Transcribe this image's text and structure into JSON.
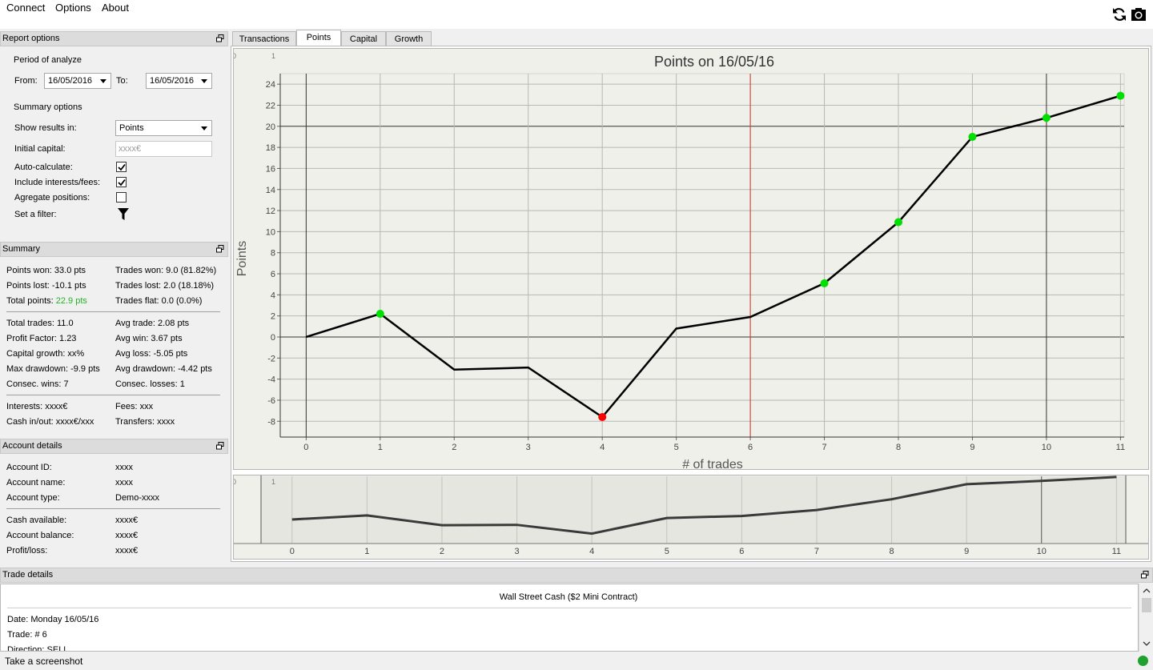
{
  "menu": {
    "connect": "Connect",
    "options": "Options",
    "about": "About"
  },
  "toolbar": {
    "refresh_icon": "refresh-icon",
    "camera_icon": "camera-icon"
  },
  "report_options": {
    "title": "Report options",
    "period_label": "Period of analyze",
    "from_label": "From:",
    "from_value": "16/05/2016",
    "to_label": "To:",
    "to_value": "16/05/2016",
    "summary_options_label": "Summary options",
    "show_results_label": "Show results in:",
    "show_results_value": "Points",
    "initial_capital_label": "Initial capital:",
    "initial_capital_placeholder": "xxxx€",
    "auto_calculate_label": "Auto-calculate:",
    "auto_calculate_checked": true,
    "include_fees_label": "Include interests/fees:",
    "include_fees_checked": true,
    "aggregate_label": "Agregate positions:",
    "aggregate_checked": false,
    "filter_label": "Set a filter:"
  },
  "summary": {
    "title": "Summary",
    "points_won": "Points won: 33.0 pts",
    "trades_won": "Trades won: 9.0 (81.82%)",
    "points_lost": "Points lost: -10.1 pts",
    "trades_lost": "Trades lost: 2.0 (18.18%)",
    "total_points_label": "Total points:",
    "total_points_value": "22.9 pts",
    "trades_flat": "Trades flat: 0.0 (0.0%)",
    "total_trades": "Total trades: 11.0",
    "avg_trade": "Avg trade: 2.08 pts",
    "profit_factor": "Profit Factor: 1.23",
    "avg_win": "Avg win: 3.67 pts",
    "capital_growth": "Capital growth: xx%",
    "avg_loss": "Avg loss: -5.05 pts",
    "max_drawdown": "Max drawdown: -9.9 pts",
    "avg_drawdown": "Avg drawdown: -4.42 pts",
    "consec_wins": "Consec. wins: 7",
    "consec_losses": "Consec. losses: 1",
    "interests": "Interests: xxxx€",
    "fees": "Fees: xxx",
    "cash_inout": "Cash in/out: xxxx€/xxx",
    "transfers": "Transfers: xxxx",
    "positive_color": "#22b422"
  },
  "account": {
    "title": "Account details",
    "id_label": "Account ID:",
    "id_value": "xxxx",
    "name_label": "Account name:",
    "name_value": "xxxx",
    "type_label": "Account type:",
    "type_value": "Demo-xxxx",
    "cash_label": "Cash available:",
    "cash_value": "xxxx€",
    "balance_label": "Account balance:",
    "balance_value": "xxxx€",
    "pl_label": "Profit/loss:",
    "pl_value": "xxxx€"
  },
  "tabs": [
    {
      "label": "Transactions",
      "active": false
    },
    {
      "label": "Points",
      "active": true
    },
    {
      "label": "Capital",
      "active": false
    },
    {
      "label": "Growth",
      "active": false
    }
  ],
  "chart_data": {
    "type": "line",
    "title": "Points on 16/05/16",
    "xlabel": "# of trades",
    "ylabel": "Points",
    "x": [
      0,
      1,
      2,
      3,
      4,
      5,
      6,
      7,
      8,
      9,
      10,
      11
    ],
    "values": [
      0,
      2.2,
      -3.1,
      -2.9,
      -7.6,
      0.8,
      1.9,
      5.1,
      10.9,
      19.0,
      20.8,
      22.9
    ],
    "marker": [
      "none",
      "win",
      "none",
      "none",
      "loss",
      "none",
      "none",
      "win",
      "win",
      "win",
      "win",
      "win"
    ],
    "xlim": [
      -0.35,
      11.05
    ],
    "ylim": [
      -9.5,
      25
    ],
    "yticks": [
      -8,
      -6,
      -4,
      -2,
      0,
      2,
      4,
      6,
      8,
      10,
      12,
      14,
      16,
      18,
      20,
      22,
      24
    ],
    "xticks": [
      0,
      1,
      2,
      3,
      4,
      5,
      6,
      7,
      8,
      9,
      10,
      11
    ],
    "selected_x": 6,
    "grid": true,
    "corner_labels": [
      "0",
      "1"
    ],
    "colors": {
      "line": "#000000",
      "win": "#00e000",
      "loss": "#ff0000",
      "cursor": "#c0392b",
      "overview_line": "#3a3a3a"
    }
  },
  "trade_details": {
    "title": "Trade details",
    "instrument": "Wall Street Cash ($2 Mini Contract)",
    "date": "Date: Monday 16/05/16",
    "trade": "Trade: # 6",
    "direction": "Direction: SELL"
  },
  "status": {
    "text": "Take a screenshot",
    "indicator_color": "#1fa12f"
  }
}
